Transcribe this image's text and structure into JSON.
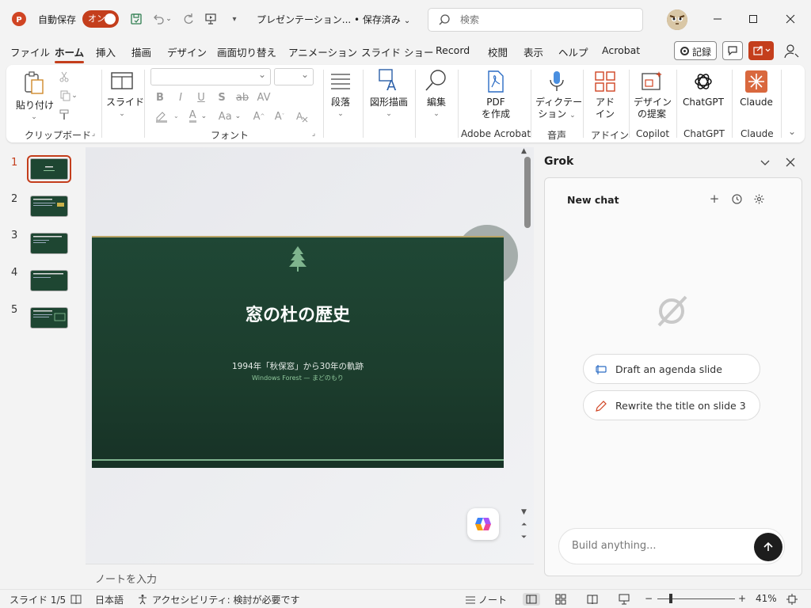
{
  "titlebar": {
    "autosave_label": "自動保存",
    "autosave_toggle": "オン",
    "doc_title": "プレゼンテーション... • 保存済み",
    "search_placeholder": "検索"
  },
  "menu": {
    "tabs": [
      "ファイル",
      "ホーム",
      "挿入",
      "描画",
      "デザイン",
      "画面切り替え",
      "アニメーション",
      "スライド ショー",
      "Record",
      "校閲",
      "表示",
      "ヘルプ",
      "Acrobat"
    ],
    "active_tab": "ホーム",
    "record_label": "記録"
  },
  "ribbon": {
    "paste": "貼り付け",
    "clipboard_group": "クリップボード",
    "slide": "スライド",
    "font_group": "フォント",
    "font_buttons": [
      "B",
      "I",
      "U",
      "S",
      "ab",
      "AV",
      "A",
      "Aa"
    ],
    "paragraph": "段落",
    "shape_drawing": "図形描画",
    "edit": "編集",
    "pdf_line1": "PDF",
    "pdf_line2": "を作成",
    "acrobat_group": "Adobe Acrobat",
    "dictate_line1": "ディクテー",
    "dictate_line2": "ション",
    "voice_group": "音声",
    "addin_line1": "アド",
    "addin_line2": "イン",
    "addin_group": "アドイン",
    "designer_line1": "デザイン",
    "designer_line2": "の提案",
    "copilot_group": "Copilot",
    "chatgpt": "ChatGPT",
    "chatgpt_group": "ChatGPT",
    "claude": "Claude",
    "claude_group": "Claude"
  },
  "thumbnails": {
    "numbers": [
      "1",
      "2",
      "3",
      "4",
      "5"
    ],
    "active": 1
  },
  "slide": {
    "title": "窓の杜の歴史",
    "subtitle": "1994年「秋保窓」から30年の軌跡",
    "subtitle2": "Windows Forest — まどのもり"
  },
  "notes": {
    "placeholder": "ノートを入力"
  },
  "grok": {
    "title": "Grok",
    "new_chat": "New chat",
    "suggestions": [
      "Draft an agenda slide",
      "Rewrite the title on slide 3"
    ],
    "input_placeholder": "Build anything..."
  },
  "status": {
    "slide_counter": "スライド 1/5",
    "language": "日本語",
    "accessibility": "アクセシビリティ: 検討が必要です",
    "notes_btn": "ノート",
    "zoom": "41%"
  },
  "colors": {
    "accent": "#c43e1c",
    "slide_bg": "#1f4735",
    "slide_accent": "#8fc79b"
  }
}
